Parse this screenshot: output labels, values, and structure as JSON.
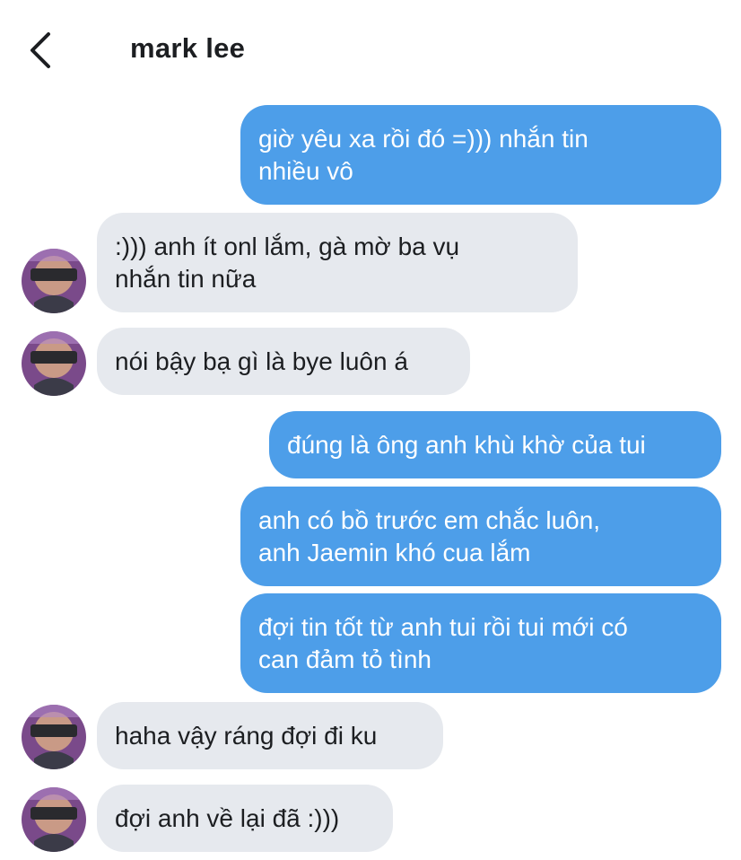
{
  "header": {
    "back_icon": "chevron-left-icon",
    "contact_name": "mark lee"
  },
  "colors": {
    "outgoing_bubble": "#4d9ee9",
    "incoming_bubble": "#e6e9ee",
    "avatar_background": "#7a4a8a"
  },
  "messages": [
    {
      "sender": "me",
      "text": "giờ yêu xa rồi đó =))) nhắn tin\nnhiều vô"
    },
    {
      "sender": "mark lee",
      "text": ":))) anh ít onl lắm, gà mờ ba vụ\nnhắn tin nữa"
    },
    {
      "sender": "mark lee",
      "text": "nói bậy bạ gì là bye luôn á"
    },
    {
      "sender": "me",
      "text": "đúng là ông anh khù khờ của tui"
    },
    {
      "sender": "me",
      "text": "anh có bồ trước em chắc luôn,\nanh Jaemin khó cua lắm"
    },
    {
      "sender": "me",
      "text": "đợi tin tốt từ anh tui rồi tui mới có\ncan đảm tỏ tình"
    },
    {
      "sender": "mark lee",
      "text": "haha vậy ráng đợi đi ku"
    },
    {
      "sender": "mark lee",
      "text": "đợi anh về lại đã :)))"
    }
  ]
}
